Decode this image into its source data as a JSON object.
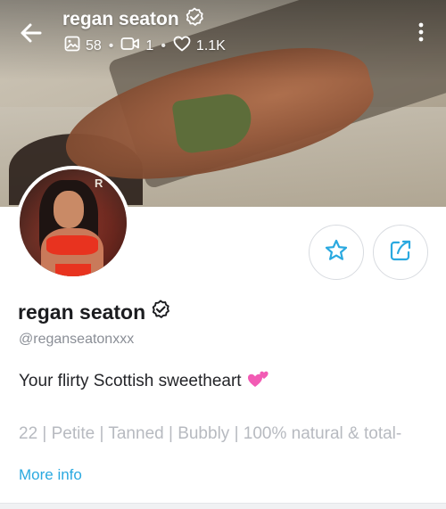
{
  "header": {
    "title": "regan seaton",
    "stats": {
      "photos": "58",
      "videos": "1",
      "likes": "1.1K"
    }
  },
  "profile": {
    "name": "regan seaton",
    "handle": "@reganseatonxxx",
    "bio": "Your flirty Scottish sweetheart",
    "bio_emoji": "💕",
    "details": "22 | Petite | Tanned | Bubbly | 100% natural & total-",
    "more_info": "More info",
    "avatar_letter": "R"
  },
  "icons": {
    "back": "arrow-left-icon",
    "verified": "verified-badge-icon",
    "photos": "image-icon",
    "videos": "video-icon",
    "likes": "heart-icon",
    "menu": "more-vertical-icon",
    "favorite": "star-icon",
    "share": "share-icon"
  },
  "colors": {
    "accent": "#2aa9e0",
    "name_text": "#1b1c1f",
    "muted_text": "#8a8e96"
  }
}
